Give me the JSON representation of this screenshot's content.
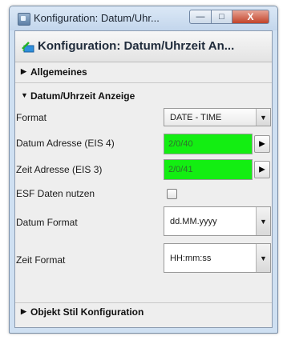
{
  "window": {
    "title": "Konfiguration: Datum/Uhr...",
    "minimize_label": "—",
    "maximize_label": "□",
    "close_label": "X"
  },
  "panel": {
    "title": "Konfiguration: Datum/Uhrzeit An..."
  },
  "sections": {
    "allgemeines": {
      "label": "Allgemeines",
      "arrow": "▶",
      "expanded": false
    },
    "datum_anzeige": {
      "label": "Datum/Uhrzeit Anzeige",
      "arrow": "▼",
      "expanded": true
    },
    "objekt_stil": {
      "label": "Objekt Stil Konfiguration",
      "arrow": "▶",
      "expanded": false
    }
  },
  "fields": {
    "format": {
      "label": "Format",
      "value": "DATE - TIME",
      "dropdown_icon": "▼"
    },
    "datum_adresse": {
      "label": "Datum Adresse (EIS 4)",
      "value": "2/0/40",
      "button_icon": "▶"
    },
    "zeit_adresse": {
      "label": "Zeit Adresse (EIS 3)",
      "value": "2/0/41",
      "button_icon": "▶"
    },
    "esf_daten": {
      "label": "ESF Daten nutzen",
      "checked": false
    },
    "datum_format": {
      "label": "Datum Format",
      "value": "dd.MM.yyyy",
      "dropdown_icon": "▼"
    },
    "zeit_format": {
      "label": "Zeit Format",
      "value": "HH:mm:ss",
      "dropdown_icon": "▼"
    }
  },
  "colors": {
    "address_field": "#13ee12",
    "panel_background": "#eeeeee"
  }
}
